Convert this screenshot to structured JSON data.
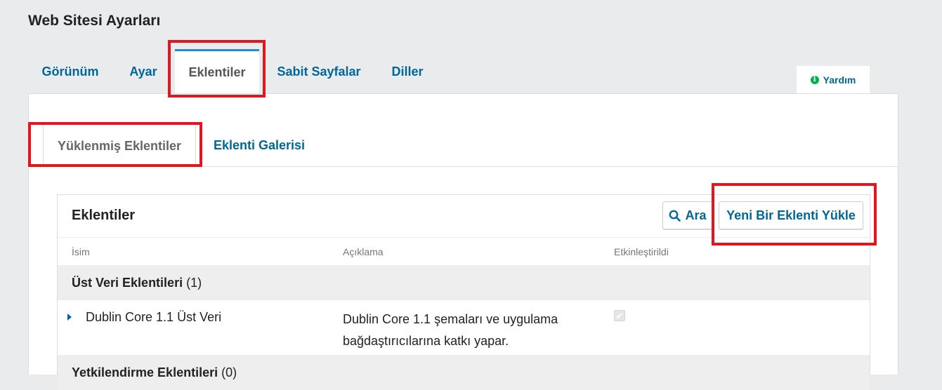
{
  "page": {
    "title": "Web Sitesi Ayarları"
  },
  "main_tabs": [
    {
      "label": "Görünüm"
    },
    {
      "label": "Ayar"
    },
    {
      "label": "Eklentiler"
    },
    {
      "label": "Sabit Sayfalar"
    },
    {
      "label": "Diller"
    }
  ],
  "main_tab_active": "Eklentiler",
  "help": {
    "label": "Yardım"
  },
  "sub_tabs": [
    {
      "label": "Yüklenmiş Eklentiler"
    },
    {
      "label": "Eklenti Galerisi"
    }
  ],
  "sub_tab_active": "Yüklenmiş Eklentiler",
  "grid": {
    "title": "Eklentiler",
    "search_label": "Ara",
    "upload_label": "Yeni Bir Eklenti Yükle",
    "columns": [
      "İsim",
      "Açıklama",
      "Etkinleştirildi"
    ],
    "categories": [
      {
        "name": "Üst Veri Eklentileri",
        "count": "(1)",
        "plugins": [
          {
            "name": "Dublin Core 1.1 Üst Veri",
            "description": "Dublin Core 1.1 şemaları ve uygulama bağdaştırıcılarına katkı yapar.",
            "enabled": true
          }
        ]
      },
      {
        "name": "Yetkilendirme Eklentileri",
        "count": "(0)",
        "plugins": []
      }
    ]
  },
  "colors": {
    "link": "#006798",
    "highlight": "#e3161e",
    "active_tab_border": "#1e8fd1",
    "help_icon": "#00b24e"
  }
}
